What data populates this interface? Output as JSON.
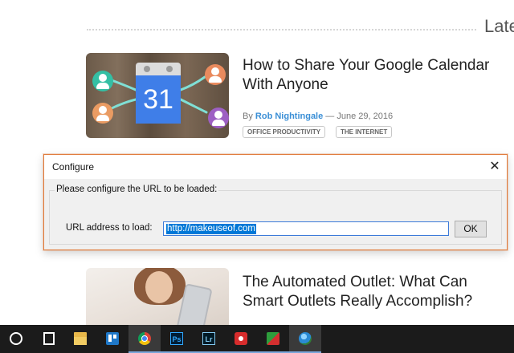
{
  "page": {
    "section_heading": "Late",
    "articles": [
      {
        "title": "How to Share Your Google Calendar With Anyone",
        "by_label": "By",
        "author": "Rob Nightingale",
        "date": "— June 29, 2016",
        "tags": [
          "OFFICE PRODUCTIVITY",
          "THE INTERNET"
        ],
        "thumbnail_number": "31"
      },
      {
        "title": "The Automated Outlet: What Can Smart Outlets Really Accomplish?"
      }
    ]
  },
  "dialog": {
    "title": "Configure",
    "close_glyph": "✕",
    "group_label": "Please configure the URL to be loaded:",
    "field_label": "URL address to load:",
    "url_value": "http://makeuseof.com",
    "ok_label": "OK"
  },
  "taskbar": {
    "items": [
      {
        "icon": "cortana-icon",
        "active": false
      },
      {
        "icon": "task-view-icon",
        "active": false
      },
      {
        "icon": "file-explorer-icon",
        "active": false
      },
      {
        "icon": "trello-icon",
        "active": false
      },
      {
        "icon": "chrome-icon",
        "active": true
      },
      {
        "icon": "photoshop-icon",
        "label": "Ps",
        "active": false
      },
      {
        "icon": "lightroom-icon",
        "label": "Lr",
        "active": false
      },
      {
        "icon": "app-icon",
        "active": false
      },
      {
        "icon": "app-icon",
        "active": false
      },
      {
        "icon": "globe-icon",
        "active": true
      }
    ]
  },
  "colors": {
    "dialog_border": "#e07a3a",
    "selection": "#0078d7",
    "author_link": "#3b8fd6",
    "taskbar": "#1b1b1b"
  }
}
